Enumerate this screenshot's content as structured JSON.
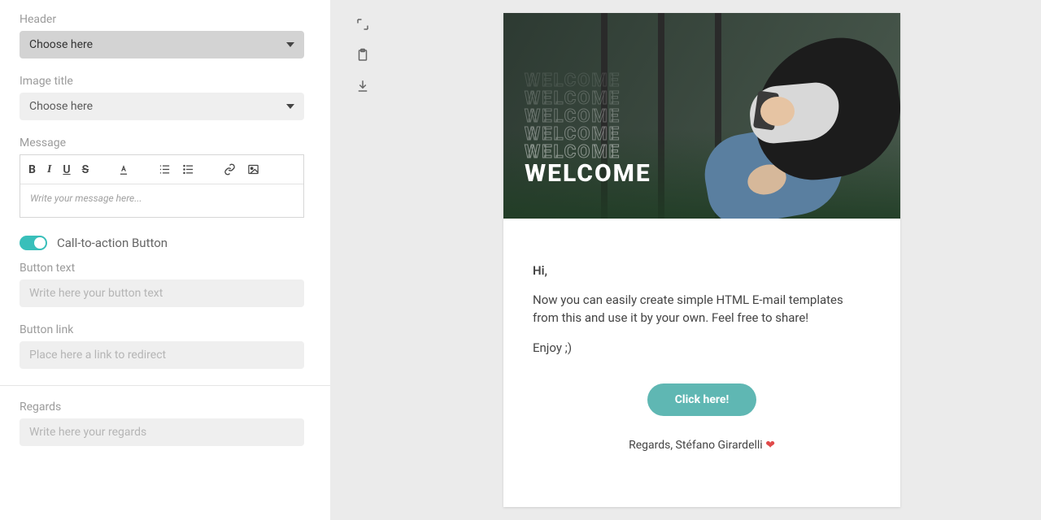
{
  "form": {
    "header": {
      "label": "Header",
      "value": "Choose here"
    },
    "imageTitle": {
      "label": "Image title",
      "value": "Choose here"
    },
    "message": {
      "label": "Message",
      "placeholder": "Write your message here..."
    },
    "ctaToggle": {
      "label": "Call-to-action Button",
      "on": true
    },
    "buttonText": {
      "label": "Button text",
      "placeholder": "Write here your button text"
    },
    "buttonLink": {
      "label": "Button link",
      "placeholder": "Place here a link to redirect"
    },
    "regards": {
      "label": "Regards",
      "placeholder": "Write here your regards"
    }
  },
  "editorToolbar": {
    "bold": "B",
    "italic": "I",
    "underline": "U",
    "strike": "S"
  },
  "preview": {
    "heroWord": "WELCOME",
    "greeting": "Hi,",
    "body": "Now you can easily create simple HTML E-mail templates from this and use it by your own. Feel free to share!",
    "signoff": "Enjoy ;)",
    "cta": "Click here!",
    "regardsLine": "Regards, Stéfano Girardelli",
    "heart": "❤"
  },
  "colors": {
    "accent": "#39bfba",
    "ctaButton": "#5fb7b3"
  }
}
